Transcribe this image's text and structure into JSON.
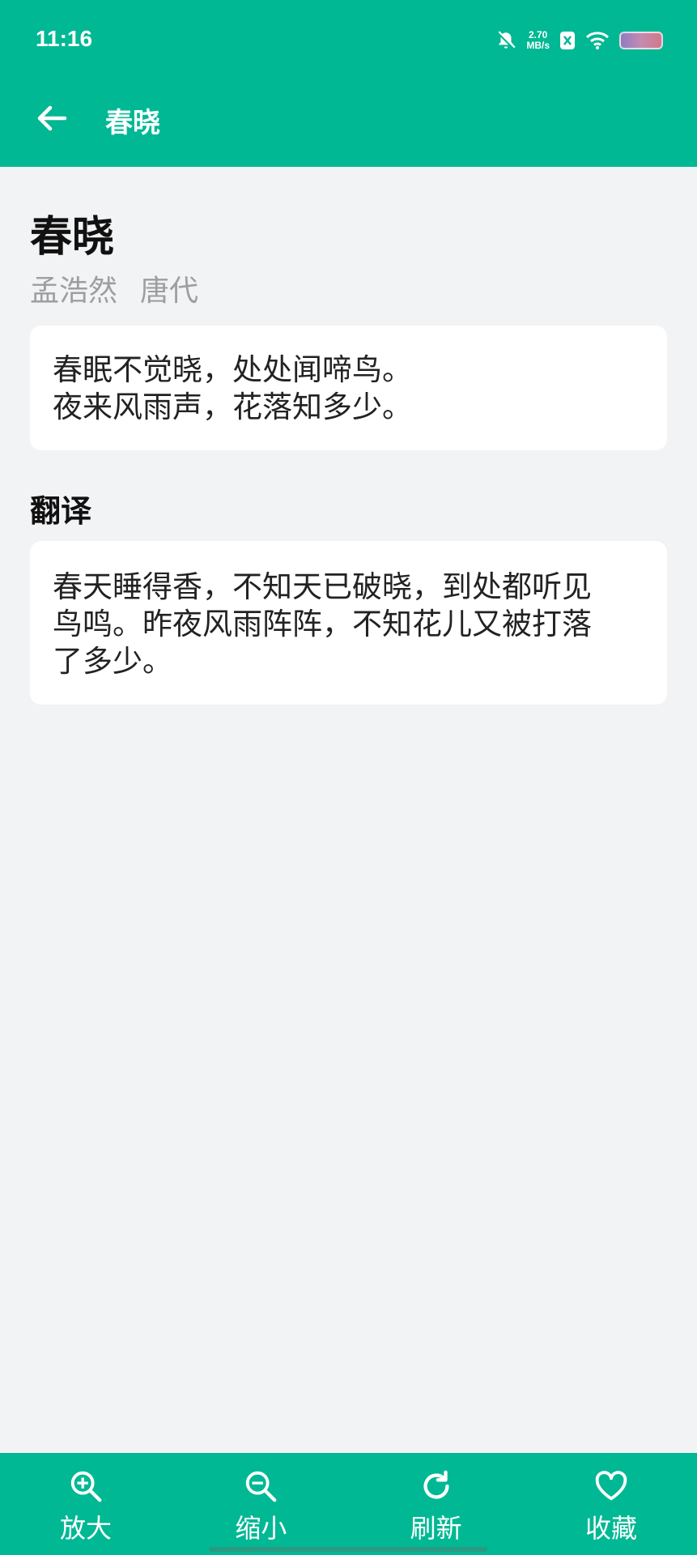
{
  "status_bar": {
    "time": "11:16",
    "net_speed_value": "2.70",
    "net_speed_unit": "MB/s"
  },
  "app_bar": {
    "title": "春晓"
  },
  "poem": {
    "title": "春晓",
    "author": "孟浩然",
    "dynasty": "唐代",
    "lines": [
      "春眠不觉晓，处处闻啼鸟。",
      "夜来风雨声，花落知多少。"
    ]
  },
  "translation": {
    "heading": "翻译",
    "lines": [
      "春天睡得香，不知天已破晓，到处都听见",
      "鸟鸣。昨夜风雨阵阵，不知花儿又被打落",
      "了多少。"
    ]
  },
  "bottom_bar": {
    "zoom_in": "放大",
    "zoom_out": "缩小",
    "refresh": "刷新",
    "favorite": "收藏"
  },
  "colors": {
    "accent": "#00b894",
    "background": "#f2f3f5"
  }
}
